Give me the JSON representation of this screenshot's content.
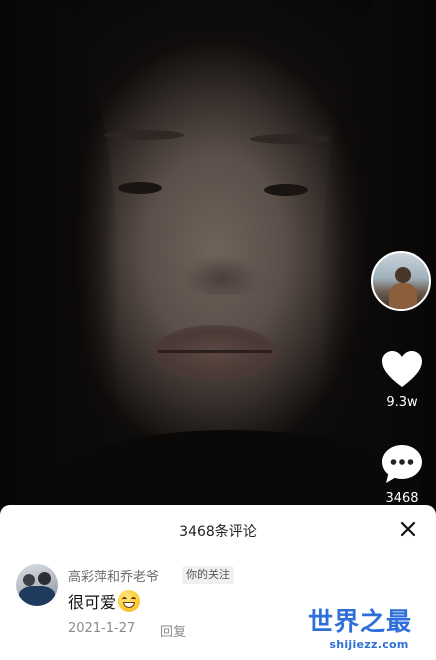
{
  "actions": {
    "like_count": "9.3w",
    "comment_count": "3468"
  },
  "comments_panel": {
    "title": "3468条评论",
    "close_icon": "close-icon",
    "comment": {
      "author": "高彩萍和乔老爷",
      "tag": "你的关注",
      "text": "很可爱",
      "emoji": "grinning-face",
      "date": "2021-1-27",
      "reply_label": "回复"
    }
  },
  "watermark": {
    "main": "世界之最",
    "sub": "shijiezz.com"
  },
  "colors": {
    "watermark": "#2f6fd8",
    "sheet_bg": "#ffffff"
  }
}
